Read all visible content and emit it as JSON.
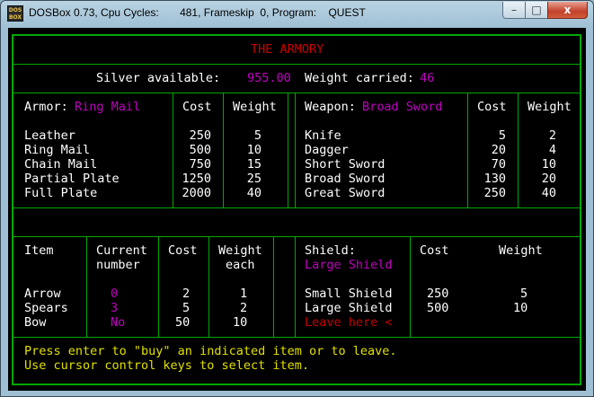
{
  "window": {
    "title": "DOSBox 0.73, Cpu Cycles:       481, Frameskip  0, Program:    QUEST",
    "app_icon_text": "DOS BOX",
    "minimize_glyph": "–",
    "maximize_glyph": "□",
    "close_glyph": "x"
  },
  "colors": {
    "border": "#00a800",
    "text": "#ffffff",
    "highlight": "#c000c0",
    "heading": "#c80000",
    "help": "#e0e000"
  },
  "heading": "THE ARMORY",
  "status": {
    "silver_label": "Silver available:",
    "silver_value": "955.00",
    "weight_label": "Weight carried:",
    "weight_value": "46"
  },
  "armor": {
    "label": "Armor:",
    "selected": "Ring Mail",
    "cost_header": "Cost",
    "weight_header": "Weight",
    "items": [
      {
        "name": "Leather",
        "cost": "250",
        "weight": "5"
      },
      {
        "name": "Ring Mail",
        "cost": "500",
        "weight": "10"
      },
      {
        "name": "Chain Mail",
        "cost": "750",
        "weight": "15"
      },
      {
        "name": "Partial Plate",
        "cost": "1250",
        "weight": "25"
      },
      {
        "name": "Full Plate",
        "cost": "2000",
        "weight": "40"
      }
    ]
  },
  "weapon": {
    "label": "Weapon:",
    "selected": "Broad Sword",
    "cost_header": "Cost",
    "weight_header": "Weight",
    "items": [
      {
        "name": "Knife",
        "cost": "5",
        "weight": "2"
      },
      {
        "name": "Dagger",
        "cost": "20",
        "weight": "4"
      },
      {
        "name": "Short Sword",
        "cost": "70",
        "weight": "10"
      },
      {
        "name": "Broad Sword",
        "cost": "130",
        "weight": "20"
      },
      {
        "name": "Great Sword",
        "cost": "250",
        "weight": "40"
      }
    ]
  },
  "items": {
    "item_header": "Item",
    "current_header_1": "Current",
    "current_header_2": "number",
    "cost_header": "Cost",
    "weight_header_1": "Weight",
    "weight_header_2": "each",
    "rows": [
      {
        "name": "Arrow",
        "current": "0",
        "cost": "2",
        "weight": "1"
      },
      {
        "name": "Spears",
        "current": "3",
        "cost": "5",
        "weight": "2"
      },
      {
        "name": "Bow",
        "current": "No",
        "cost": "50",
        "weight": "10"
      }
    ]
  },
  "shield": {
    "label": "Shield:",
    "selected": "Large Shield",
    "cost_header": "Cost",
    "weight_header": "Weight",
    "items": [
      {
        "name": "Small Shield",
        "cost": "250",
        "weight": "5"
      },
      {
        "name": "Large Shield",
        "cost": "500",
        "weight": "10"
      }
    ],
    "leave": "Leave here <"
  },
  "help": {
    "line1": "Press enter to \"buy\" an indicated item or to leave.",
    "line2": "Use cursor control keys to select item."
  }
}
